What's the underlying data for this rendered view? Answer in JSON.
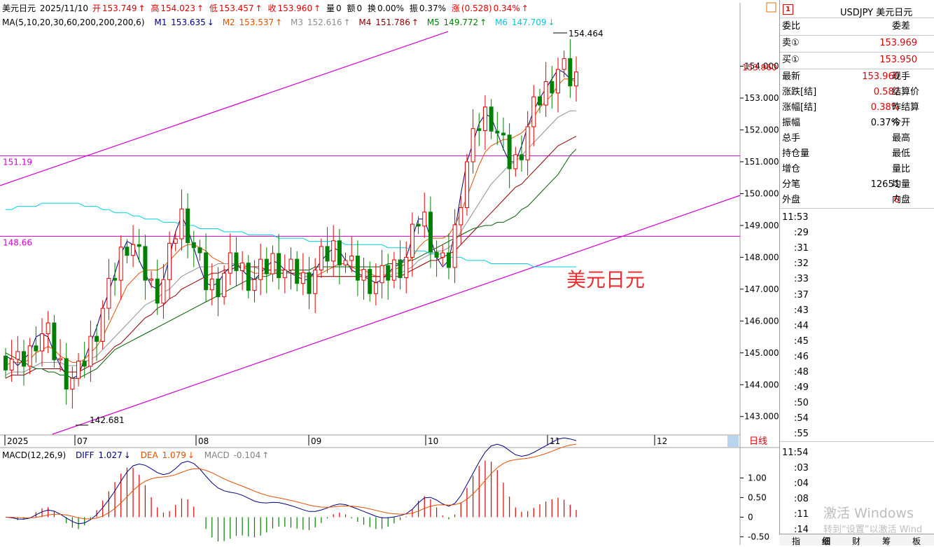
{
  "header": {
    "title": "美元日元",
    "date": "2025/11/10",
    "open_label": "开",
    "open": "153.749",
    "high_label": "高",
    "high": "154.023",
    "low_label": "低",
    "low": "153.457",
    "close_label": "收",
    "close": "153.960",
    "vol_label": "量",
    "vol": "0",
    "amt_label": "额",
    "amt": "0",
    "turnover_label": "换",
    "turnover": "0.00%",
    "amp_label": "振",
    "amp": "0.37%",
    "chg_label": "涨",
    "chg": "(0.528)",
    "chg_pct": "0.34%"
  },
  "ma_header": {
    "name": "MA(5,10,20,30,60,200,200,200,6)",
    "m1_label": "M1",
    "m1": "153.635",
    "m2_label": "M2",
    "m2": "153.537",
    "m3_label": "M3",
    "m3": "152.616",
    "m4_label": "M4",
    "m4": "151.786",
    "m5_label": "M5",
    "m5": "149.772",
    "m6_label": "M6",
    "m6": "147.709",
    "arrow_up": "↑",
    "arrow_down": "↓"
  },
  "macd_header": {
    "name": "MACD(12,26,9)",
    "diff_label": "DIFF",
    "diff": "1.027",
    "dea_label": "DEA",
    "dea": "1.079",
    "macd_label": "MACD",
    "macd": "-0.104"
  },
  "price_axis": [
    "154.000",
    "153.000",
    "152.000",
    "151.000",
    "150.000",
    "149.000",
    "148.000",
    "147.000",
    "146.000",
    "145.000",
    "144.000",
    "143.000"
  ],
  "current_price_tag": "153.960",
  "hlines": [
    {
      "label": "151.19",
      "value": 151.19
    },
    {
      "label": "148.66",
      "value": 148.66
    }
  ],
  "hi_label": "154.464",
  "lo_label": "142.681",
  "watermark_text": "美元日元",
  "x_labels": [
    "2025",
    "07",
    "08",
    "09",
    "10",
    "11",
    "12"
  ],
  "period_label": "日线",
  "macd_axis": [
    "1.00",
    "0.50",
    "0",
    "-0.50"
  ],
  "colors": {
    "up": "#e00000",
    "down": "#008000",
    "m1": "#000080",
    "m2": "#e05000",
    "m3": "#909090",
    "m4": "#900000",
    "m5": "#006000",
    "m6": "#00d0e0",
    "channel": "#d000d0",
    "dea": "#e05000",
    "diff": "#000080"
  },
  "chart_data": {
    "type": "candlestick",
    "title": "美元日元",
    "ylim": [
      142.4,
      155.2
    ],
    "series": [
      {
        "name": "M1",
        "values": [
          144.9,
          144.8,
          144.6,
          144.8,
          145.0,
          145.5,
          145.6,
          145.5,
          145.0,
          144.6,
          144.3,
          144.2,
          144.3,
          144.8,
          145.3,
          145.8,
          146.4,
          146.9,
          147.5,
          148.1,
          148.5,
          148.4,
          147.9,
          147.5,
          147.1,
          147.0,
          147.3,
          148.0,
          148.8,
          149.3,
          148.9,
          148.3,
          147.7,
          147.2,
          147.1,
          147.2,
          147.5,
          147.7,
          147.8,
          147.6,
          147.4,
          147.3,
          147.5,
          147.7,
          147.9,
          147.8,
          147.6,
          147.5,
          147.4,
          147.3,
          147.3,
          147.6,
          147.9,
          148.1,
          148.3,
          148.2,
          147.9,
          147.6,
          147.5,
          147.4,
          147.3,
          147.2,
          147.3,
          147.5,
          147.7,
          147.8,
          148.0,
          148.6,
          149.2,
          149.2,
          148.6,
          148.0,
          147.7,
          147.9,
          148.8,
          150.0,
          151.0,
          151.6,
          152.2,
          152.5,
          152.4,
          151.9,
          151.4,
          151.0,
          151.0,
          151.5,
          152.1,
          152.6,
          153.0,
          153.3,
          153.6,
          153.9,
          153.8,
          153.6,
          153.6
        ]
      },
      {
        "name": "M2",
        "values": [
          144.6,
          144.7,
          144.7,
          144.7,
          144.8,
          145.0,
          145.1,
          145.2,
          145.1,
          144.9,
          144.8,
          144.7,
          144.7,
          144.8,
          145.0,
          145.2,
          145.5,
          145.9,
          146.3,
          146.7,
          147.1,
          147.3,
          147.5,
          147.6,
          147.6,
          147.6,
          147.7,
          147.9,
          148.1,
          148.3,
          148.4,
          148.4,
          148.3,
          148.2,
          148.0,
          147.9,
          147.8,
          147.8,
          147.8,
          147.7,
          147.6,
          147.5,
          147.5,
          147.5,
          147.5,
          147.5,
          147.5,
          147.5,
          147.5,
          147.4,
          147.4,
          147.4,
          147.5,
          147.6,
          147.7,
          147.8,
          147.8,
          147.7,
          147.6,
          147.6,
          147.5,
          147.4,
          147.4,
          147.5,
          147.6,
          147.7,
          147.8,
          148.0,
          148.3,
          148.5,
          148.6,
          148.6,
          148.6,
          148.7,
          149.0,
          149.4,
          149.9,
          150.4,
          150.9,
          151.3,
          151.5,
          151.6,
          151.7,
          151.7,
          151.8,
          151.9,
          152.1,
          152.4,
          152.7,
          152.9,
          153.1,
          153.4,
          153.6,
          153.6,
          153.5
        ]
      },
      {
        "name": "M3",
        "values": [
          144.3,
          144.4,
          144.4,
          144.4,
          144.5,
          144.6,
          144.7,
          144.7,
          144.7,
          144.7,
          144.6,
          144.6,
          144.6,
          144.7,
          144.8,
          144.9,
          145.1,
          145.3,
          145.5,
          145.7,
          145.9,
          146.1,
          146.3,
          146.5,
          146.6,
          146.7,
          146.9,
          147.0,
          147.2,
          147.4,
          147.5,
          147.6,
          147.7,
          147.7,
          147.7,
          147.8,
          147.8,
          147.8,
          147.8,
          147.8,
          147.7,
          147.7,
          147.6,
          147.6,
          147.6,
          147.5,
          147.5,
          147.5,
          147.5,
          147.4,
          147.4,
          147.4,
          147.4,
          147.4,
          147.4,
          147.4,
          147.4,
          147.4,
          147.4,
          147.4,
          147.4,
          147.4,
          147.4,
          147.4,
          147.5,
          147.5,
          147.6,
          147.7,
          147.9,
          148.0,
          148.1,
          148.2,
          148.2,
          148.3,
          148.5,
          148.8,
          149.1,
          149.4,
          149.7,
          150.0,
          150.3,
          150.5,
          150.7,
          150.9,
          151.0,
          151.2,
          151.4,
          151.6,
          151.8,
          152.0,
          152.2,
          152.4,
          152.5,
          152.6,
          152.6
        ]
      },
      {
        "name": "M4",
        "values": [
          144.2,
          144.3,
          144.3,
          144.3,
          144.4,
          144.5,
          144.5,
          144.5,
          144.5,
          144.5,
          144.4,
          144.4,
          144.4,
          144.5,
          144.6,
          144.7,
          144.8,
          145.0,
          145.2,
          145.3,
          145.5,
          145.7,
          145.9,
          146.1,
          146.2,
          146.4,
          146.5,
          146.7,
          146.8,
          147.0,
          147.1,
          147.2,
          147.3,
          147.4,
          147.5,
          147.5,
          147.6,
          147.6,
          147.7,
          147.7,
          147.7,
          147.7,
          147.7,
          147.6,
          147.6,
          147.6,
          147.6,
          147.5,
          147.5,
          147.5,
          147.5,
          147.4,
          147.4,
          147.4,
          147.4,
          147.4,
          147.4,
          147.4,
          147.4,
          147.4,
          147.4,
          147.4,
          147.4,
          147.4,
          147.4,
          147.4,
          147.5,
          147.6,
          147.7,
          147.8,
          147.9,
          147.9,
          148.0,
          148.1,
          148.2,
          148.4,
          148.6,
          148.8,
          149.0,
          149.2,
          149.4,
          149.6,
          149.8,
          150.0,
          150.2,
          150.3,
          150.5,
          150.7,
          150.9,
          151.1,
          151.3,
          151.5,
          151.6,
          151.7,
          151.8
        ]
      },
      {
        "name": "M5",
        "values": [
          145.0,
          144.9,
          144.8,
          144.7,
          144.6,
          144.5,
          144.5,
          144.4,
          144.4,
          144.3,
          144.3,
          144.2,
          144.2,
          144.3,
          144.4,
          144.5,
          144.7,
          144.9,
          145.1,
          145.2,
          145.3,
          145.4,
          145.5,
          145.6,
          145.7,
          145.8,
          145.9,
          146.0,
          146.1,
          146.2,
          146.3,
          146.4,
          146.5,
          146.6,
          146.7,
          146.8,
          146.9,
          147.0,
          147.1,
          147.2,
          147.3,
          147.3,
          147.4,
          147.4,
          147.5,
          147.5,
          147.5,
          147.6,
          147.6,
          147.6,
          147.6,
          147.7,
          147.7,
          147.7,
          147.7,
          147.7,
          147.7,
          147.7,
          147.7,
          147.7,
          147.7,
          147.7,
          147.7,
          147.8,
          147.8,
          147.8,
          147.9,
          147.9,
          148.0,
          148.1,
          148.2,
          148.3,
          148.4,
          148.5,
          148.6,
          148.7,
          148.8,
          148.9,
          148.95,
          149.0,
          149.0,
          149.1,
          149.1,
          149.2,
          149.3,
          149.5,
          149.6,
          149.8,
          150.0,
          150.2,
          150.4,
          150.6,
          150.9,
          151.2,
          151.4
        ]
      },
      {
        "name": "M6",
        "values": [
          149.5,
          149.5,
          149.6,
          149.6,
          149.6,
          149.6,
          149.7,
          149.7,
          149.7,
          149.7,
          149.7,
          149.7,
          149.7,
          149.6,
          149.6,
          149.6,
          149.5,
          149.5,
          149.4,
          149.4,
          149.4,
          149.3,
          149.3,
          149.2,
          149.2,
          149.2,
          149.1,
          149.1,
          149.1,
          149.0,
          149.0,
          149.0,
          148.9,
          148.9,
          148.9,
          148.9,
          148.8,
          148.8,
          148.8,
          148.8,
          148.7,
          148.7,
          148.7,
          148.7,
          148.7,
          148.6,
          148.6,
          148.6,
          148.6,
          148.6,
          148.5,
          148.5,
          148.5,
          148.5,
          148.5,
          148.5,
          148.4,
          148.4,
          148.4,
          148.4,
          148.4,
          148.4,
          148.4,
          148.3,
          148.3,
          148.3,
          148.3,
          148.2,
          148.2,
          148.2,
          148.1,
          148.1,
          148.1,
          148.0,
          148.0,
          148.0,
          147.9,
          147.9,
          147.9,
          147.9,
          147.8,
          147.8,
          147.8,
          147.8,
          147.8,
          147.8,
          147.8,
          147.7,
          147.7,
          147.7,
          147.7,
          147.7,
          147.7,
          147.7,
          147.7
        ]
      }
    ]
  },
  "panel": {
    "num": "1",
    "symbol": "USDJPY 美元日元",
    "weibi_label": "委比",
    "weicha_label": "委差",
    "sell_label": "卖①",
    "sell": "153.969",
    "buy_label": "买①",
    "buy": "153.950",
    "rows": [
      {
        "l": "最新",
        "v": "153.960",
        "r": "现手",
        "color": "#e00000"
      },
      {
        "l": "涨跌[结]",
        "v": "0.582",
        "r": "结算价",
        "color": "#e00000"
      },
      {
        "l": "涨幅[结]",
        "v": "0.38%",
        "r": "昨结算",
        "color": "#e00000"
      },
      {
        "l": "振幅",
        "v": "0.37%",
        "r": "今开",
        "color": "#000000"
      },
      {
        "l": "总手",
        "v": "",
        "r": "最高",
        "color": "#000000"
      },
      {
        "l": "持仓量",
        "v": "",
        "r": "最低",
        "color": "#000000"
      },
      {
        "l": "增仓",
        "v": "",
        "r": "量比",
        "color": "#000000"
      },
      {
        "l": "分笔",
        "v": "12651",
        "r": "均量",
        "color": "#000000"
      },
      {
        "l": "外盘",
        "v": "0",
        "r": "内盘",
        "color": "#e00000"
      }
    ],
    "ticks": [
      "11:53",
      ":29",
      ":31",
      ":32",
      ":33",
      ":37",
      ":43",
      ":44",
      ":45",
      ":46",
      ":48",
      ":49",
      ":50",
      ":54",
      ":55",
      "11:54",
      ":03",
      ":04",
      ":08",
      ":11",
      ":14"
    ],
    "tabs": [
      "指",
      "细",
      "财",
      "筹",
      "板"
    ],
    "activate_title": "激活 Windows",
    "activate_sub": "转到“设置”以激活 Wind"
  }
}
